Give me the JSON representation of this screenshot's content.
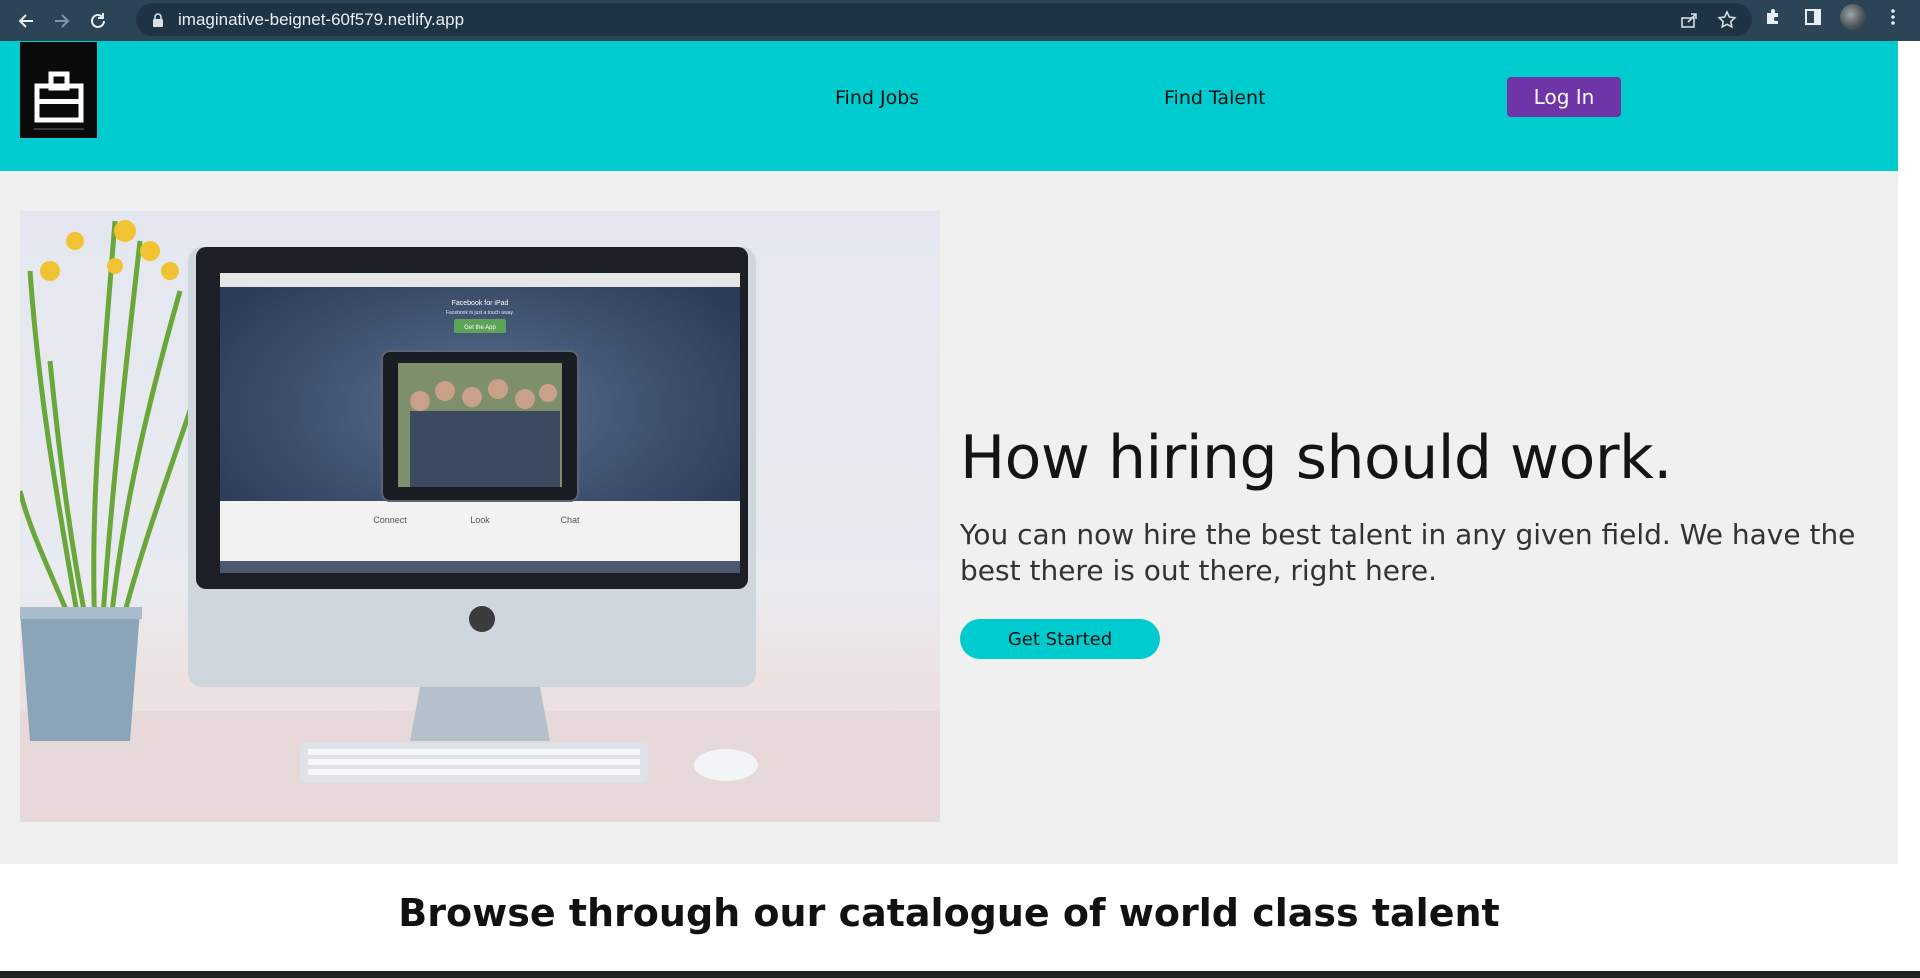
{
  "browser": {
    "url": "imaginative-beignet-60f579.netlify.app"
  },
  "header": {
    "nav": {
      "find_jobs": "Find Jobs",
      "find_talent": "Find Talent"
    },
    "login_label": "Log In"
  },
  "hero": {
    "title": "How hiring should work.",
    "subtitle": "You can now hire the best talent in any given field. We have the best there is out there, right here.",
    "cta_label": "Get Started",
    "screen_content": {
      "headline": "Facebook for iPad",
      "tagline": "Facebook is just a touch away.",
      "button": "Get the App",
      "features": [
        "Connect",
        "Look",
        "Chat"
      ]
    }
  },
  "catalogue": {
    "title": "Browse through our catalogue of world class talent"
  },
  "colors": {
    "header_bg": "#00cccf",
    "login_bg": "#6f35a8",
    "cta_bg": "#00cccf",
    "hero_bg": "#f0f0f0",
    "chrome_bg": "#2b4556"
  },
  "icons": {
    "back": "arrow-left-icon",
    "forward": "arrow-right-icon",
    "reload": "reload-icon",
    "lock": "lock-icon",
    "share": "share-icon",
    "bookmark": "star-icon",
    "extensions": "puzzle-icon",
    "sidepanel": "side-panel-icon",
    "menu": "kebab-menu-icon",
    "logo": "briefcase-logo-icon"
  }
}
